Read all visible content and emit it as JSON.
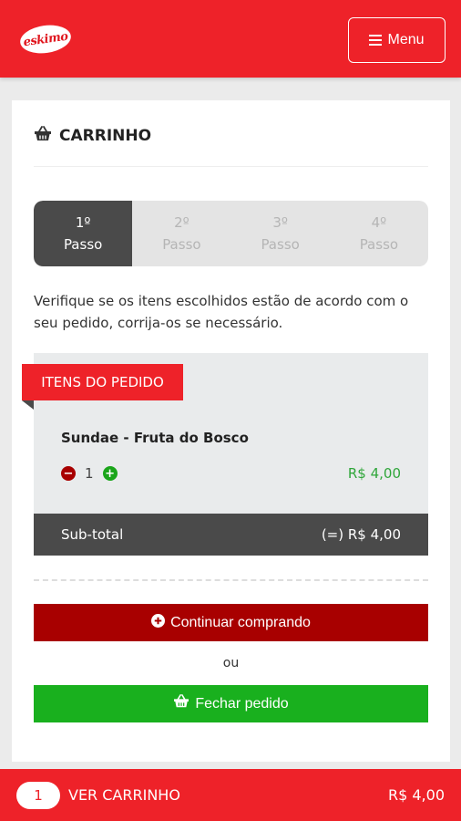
{
  "header": {
    "logo_text": "eskimo",
    "menu_label": "Menu"
  },
  "cart": {
    "title": "CARRINHO",
    "steps": [
      {
        "number": "1º",
        "label": "Passo",
        "active": true
      },
      {
        "number": "2º",
        "label": "Passo",
        "active": false
      },
      {
        "number": "3º",
        "label": "Passo",
        "active": false
      },
      {
        "number": "4º",
        "label": "Passo",
        "active": false
      }
    ],
    "instructions": "Verifique se os itens escolhidos estão de acordo com o seu pedido, corrija-os se necessário.",
    "order_section_label": "ITENS DO PEDIDO",
    "items": [
      {
        "name": "Sundae - Fruta do Bosco",
        "quantity": "1",
        "price": "R$ 4,00"
      }
    ],
    "subtotal_label": "Sub-total",
    "subtotal_value": "(=) R$ 4,00",
    "continue_label": "Continuar comprando",
    "or_label": "ou",
    "checkout_label": "Fechar pedido"
  },
  "bottom_bar": {
    "count": "1",
    "cart_label": "VER CARRINHO",
    "total": "R$ 4,00"
  },
  "colors": {
    "brand_red": "#ee2229",
    "dark_red": "#a80000",
    "green": "#19b01e",
    "price_green": "#2fa63a",
    "dark_gray": "#4a4a4a"
  }
}
